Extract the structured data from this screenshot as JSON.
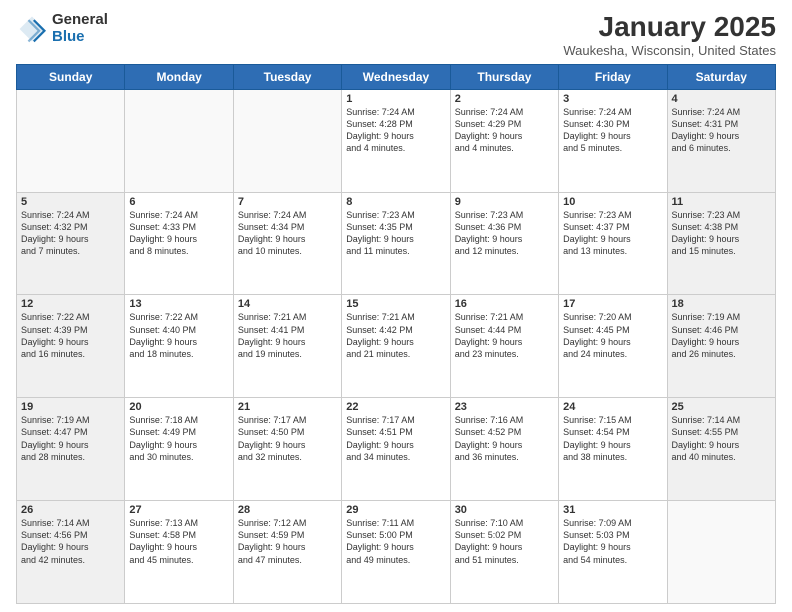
{
  "header": {
    "logo_general": "General",
    "logo_blue": "Blue",
    "month_year": "January 2025",
    "location": "Waukesha, Wisconsin, United States"
  },
  "weekdays": [
    "Sunday",
    "Monday",
    "Tuesday",
    "Wednesday",
    "Thursday",
    "Friday",
    "Saturday"
  ],
  "weeks": [
    [
      {
        "day": "",
        "info": "",
        "empty": true
      },
      {
        "day": "",
        "info": "",
        "empty": true
      },
      {
        "day": "",
        "info": "",
        "empty": true
      },
      {
        "day": "1",
        "info": "Sunrise: 7:24 AM\nSunset: 4:28 PM\nDaylight: 9 hours\nand 4 minutes.",
        "shaded": false
      },
      {
        "day": "2",
        "info": "Sunrise: 7:24 AM\nSunset: 4:29 PM\nDaylight: 9 hours\nand 4 minutes.",
        "shaded": false
      },
      {
        "day": "3",
        "info": "Sunrise: 7:24 AM\nSunset: 4:30 PM\nDaylight: 9 hours\nand 5 minutes.",
        "shaded": false
      },
      {
        "day": "4",
        "info": "Sunrise: 7:24 AM\nSunset: 4:31 PM\nDaylight: 9 hours\nand 6 minutes.",
        "shaded": true
      }
    ],
    [
      {
        "day": "5",
        "info": "Sunrise: 7:24 AM\nSunset: 4:32 PM\nDaylight: 9 hours\nand 7 minutes.",
        "shaded": true
      },
      {
        "day": "6",
        "info": "Sunrise: 7:24 AM\nSunset: 4:33 PM\nDaylight: 9 hours\nand 8 minutes.",
        "shaded": false
      },
      {
        "day": "7",
        "info": "Sunrise: 7:24 AM\nSunset: 4:34 PM\nDaylight: 9 hours\nand 10 minutes.",
        "shaded": false
      },
      {
        "day": "8",
        "info": "Sunrise: 7:23 AM\nSunset: 4:35 PM\nDaylight: 9 hours\nand 11 minutes.",
        "shaded": false
      },
      {
        "day": "9",
        "info": "Sunrise: 7:23 AM\nSunset: 4:36 PM\nDaylight: 9 hours\nand 12 minutes.",
        "shaded": false
      },
      {
        "day": "10",
        "info": "Sunrise: 7:23 AM\nSunset: 4:37 PM\nDaylight: 9 hours\nand 13 minutes.",
        "shaded": false
      },
      {
        "day": "11",
        "info": "Sunrise: 7:23 AM\nSunset: 4:38 PM\nDaylight: 9 hours\nand 15 minutes.",
        "shaded": true
      }
    ],
    [
      {
        "day": "12",
        "info": "Sunrise: 7:22 AM\nSunset: 4:39 PM\nDaylight: 9 hours\nand 16 minutes.",
        "shaded": true
      },
      {
        "day": "13",
        "info": "Sunrise: 7:22 AM\nSunset: 4:40 PM\nDaylight: 9 hours\nand 18 minutes.",
        "shaded": false
      },
      {
        "day": "14",
        "info": "Sunrise: 7:21 AM\nSunset: 4:41 PM\nDaylight: 9 hours\nand 19 minutes.",
        "shaded": false
      },
      {
        "day": "15",
        "info": "Sunrise: 7:21 AM\nSunset: 4:42 PM\nDaylight: 9 hours\nand 21 minutes.",
        "shaded": false
      },
      {
        "day": "16",
        "info": "Sunrise: 7:21 AM\nSunset: 4:44 PM\nDaylight: 9 hours\nand 23 minutes.",
        "shaded": false
      },
      {
        "day": "17",
        "info": "Sunrise: 7:20 AM\nSunset: 4:45 PM\nDaylight: 9 hours\nand 24 minutes.",
        "shaded": false
      },
      {
        "day": "18",
        "info": "Sunrise: 7:19 AM\nSunset: 4:46 PM\nDaylight: 9 hours\nand 26 minutes.",
        "shaded": true
      }
    ],
    [
      {
        "day": "19",
        "info": "Sunrise: 7:19 AM\nSunset: 4:47 PM\nDaylight: 9 hours\nand 28 minutes.",
        "shaded": true
      },
      {
        "day": "20",
        "info": "Sunrise: 7:18 AM\nSunset: 4:49 PM\nDaylight: 9 hours\nand 30 minutes.",
        "shaded": false
      },
      {
        "day": "21",
        "info": "Sunrise: 7:17 AM\nSunset: 4:50 PM\nDaylight: 9 hours\nand 32 minutes.",
        "shaded": false
      },
      {
        "day": "22",
        "info": "Sunrise: 7:17 AM\nSunset: 4:51 PM\nDaylight: 9 hours\nand 34 minutes.",
        "shaded": false
      },
      {
        "day": "23",
        "info": "Sunrise: 7:16 AM\nSunset: 4:52 PM\nDaylight: 9 hours\nand 36 minutes.",
        "shaded": false
      },
      {
        "day": "24",
        "info": "Sunrise: 7:15 AM\nSunset: 4:54 PM\nDaylight: 9 hours\nand 38 minutes.",
        "shaded": false
      },
      {
        "day": "25",
        "info": "Sunrise: 7:14 AM\nSunset: 4:55 PM\nDaylight: 9 hours\nand 40 minutes.",
        "shaded": true
      }
    ],
    [
      {
        "day": "26",
        "info": "Sunrise: 7:14 AM\nSunset: 4:56 PM\nDaylight: 9 hours\nand 42 minutes.",
        "shaded": true
      },
      {
        "day": "27",
        "info": "Sunrise: 7:13 AM\nSunset: 4:58 PM\nDaylight: 9 hours\nand 45 minutes.",
        "shaded": false
      },
      {
        "day": "28",
        "info": "Sunrise: 7:12 AM\nSunset: 4:59 PM\nDaylight: 9 hours\nand 47 minutes.",
        "shaded": false
      },
      {
        "day": "29",
        "info": "Sunrise: 7:11 AM\nSunset: 5:00 PM\nDaylight: 9 hours\nand 49 minutes.",
        "shaded": false
      },
      {
        "day": "30",
        "info": "Sunrise: 7:10 AM\nSunset: 5:02 PM\nDaylight: 9 hours\nand 51 minutes.",
        "shaded": false
      },
      {
        "day": "31",
        "info": "Sunrise: 7:09 AM\nSunset: 5:03 PM\nDaylight: 9 hours\nand 54 minutes.",
        "shaded": false
      },
      {
        "day": "",
        "info": "",
        "empty": true
      }
    ]
  ]
}
